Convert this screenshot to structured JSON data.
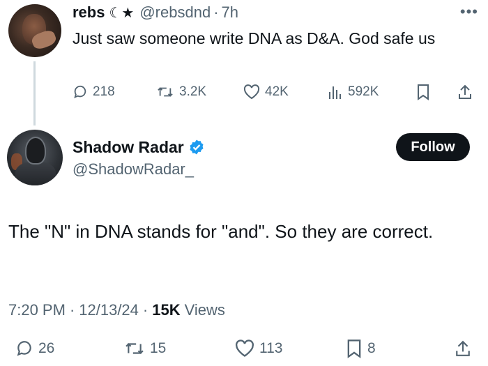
{
  "parent_tweet": {
    "name": "rebs",
    "name_glyphs": "☾★",
    "handle": "@rebsdnd",
    "separator": "·",
    "time": "7h",
    "text": "Just saw someone write DNA as D&A. God safe us",
    "more_icon": "more-horizontal-icon",
    "actions": {
      "replies": "218",
      "reposts": "3.2K",
      "likes": "42K",
      "views": "592K"
    },
    "icons": [
      "reply-icon",
      "repost-icon",
      "like-icon",
      "views-icon",
      "bookmark-icon",
      "share-icon"
    ]
  },
  "main_tweet": {
    "name": "Shadow Radar",
    "handle": "@ShadowRadar_",
    "verified": true,
    "follow_label": "Follow",
    "text": "The \"N\" in DNA stands for \"and\". So they are correct.",
    "time": "7:20 PM",
    "date": "12/13/24",
    "separator": "·",
    "views_count": "15K",
    "views_label": "Views",
    "actions": {
      "replies": "26",
      "reposts": "15",
      "likes": "113",
      "bookmarks": "8"
    }
  },
  "colors": {
    "text_primary": "#0f1419",
    "text_secondary": "#536471",
    "verified_blue": "#1d9bf0",
    "thread_line": "#cfd9de",
    "follow_bg": "#0f1419"
  }
}
